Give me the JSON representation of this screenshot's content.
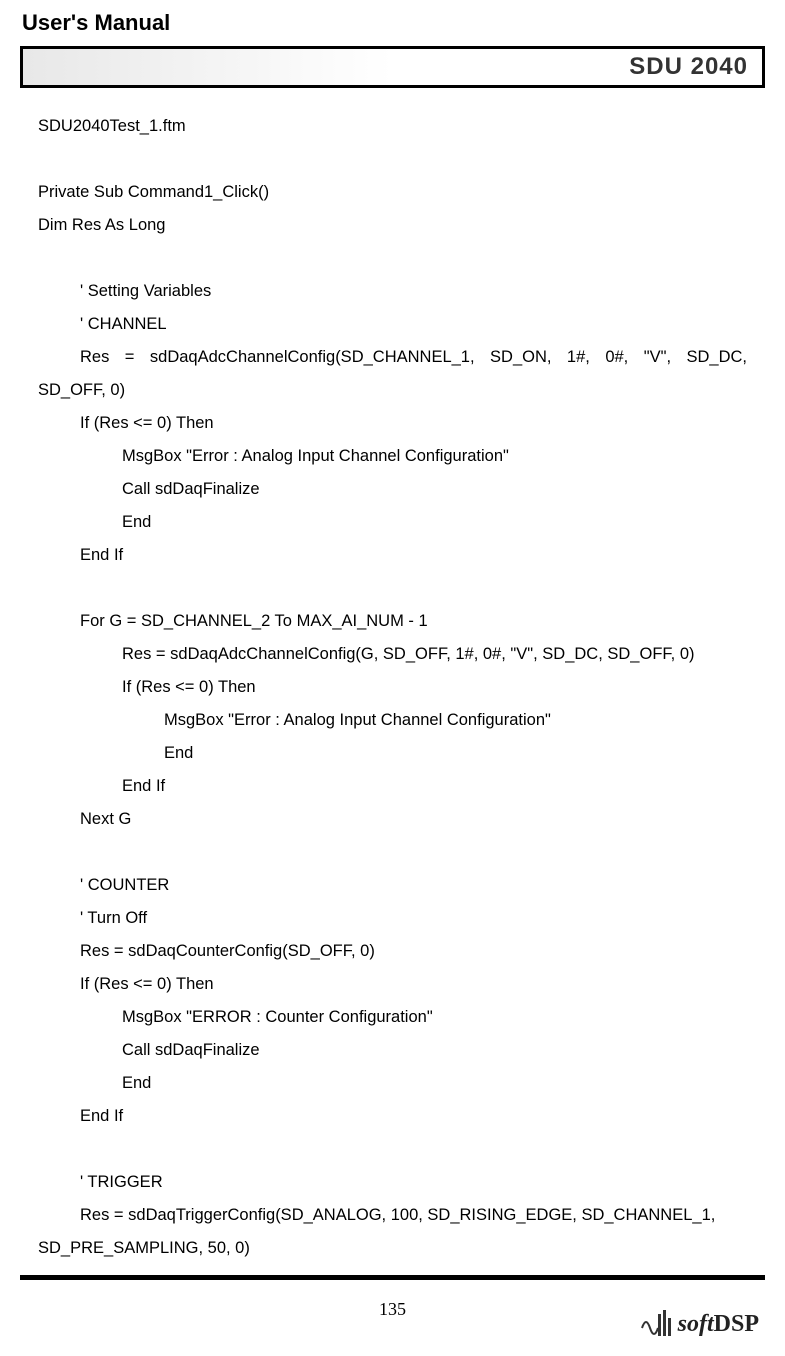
{
  "header": {
    "title": "User's Manual",
    "box_title": "SDU 2040"
  },
  "code": {
    "l1": "SDU2040Test_1.ftm",
    "l2": "Private Sub Command1_Click()",
    "l3": "Dim Res As Long",
    "l4": "' Setting Variables",
    "l5": "' CHANNEL",
    "l6": "Res = sdDaqAdcChannelConfig(SD_CHANNEL_1, SD_ON, 1#, 0#, \"V\", SD_DC,",
    "l7": "SD_OFF, 0)",
    "l8": "If (Res <= 0) Then",
    "l9": "MsgBox \"Error : Analog Input Channel Configuration\"",
    "l10": "Call sdDaqFinalize",
    "l11": "End",
    "l12": "End If",
    "l13": "For G = SD_CHANNEL_2 To MAX_AI_NUM - 1",
    "l14": "Res = sdDaqAdcChannelConfig(G, SD_OFF, 1#, 0#, \"V\", SD_DC, SD_OFF, 0)",
    "l15": "If (Res <= 0) Then",
    "l16": "MsgBox \"Error : Analog Input Channel Configuration\"",
    "l17": "End",
    "l18": "End If",
    "l19": "Next G",
    "l20": "' COUNTER",
    "l21": "' Turn Off",
    "l22": "Res = sdDaqCounterConfig(SD_OFF, 0)",
    "l23": "If (Res <= 0) Then",
    "l24": "MsgBox \"ERROR : Counter Configuration\"",
    "l25": "Call sdDaqFinalize",
    "l26": "End",
    "l27": "End If",
    "l28": "' TRIGGER",
    "l29": "Res = sdDaqTriggerConfig(SD_ANALOG, 100, SD_RISING_EDGE, SD_CHANNEL_1,",
    "l30": "SD_PRE_SAMPLING, 50, 0)"
  },
  "footer": {
    "page_number": "135",
    "logo_text_soft": "soft",
    "logo_text_dsp": "DSP"
  }
}
